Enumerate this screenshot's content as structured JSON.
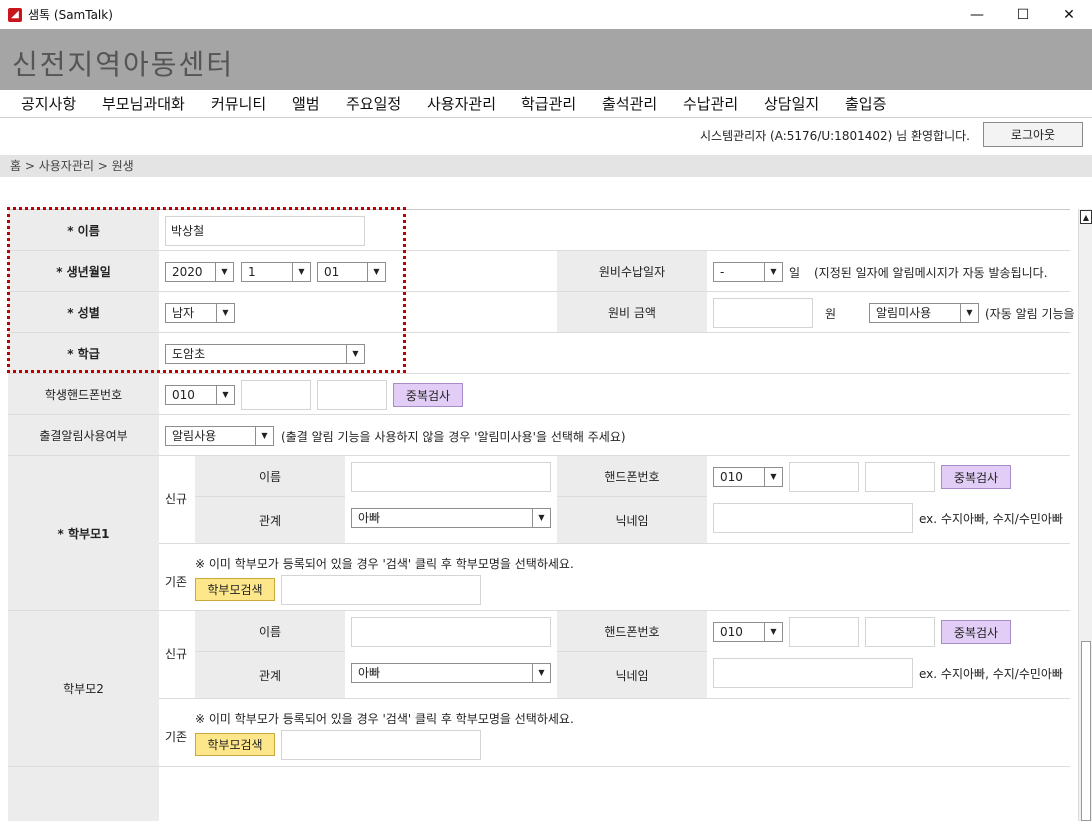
{
  "window": {
    "title": "샘톡 (SamTalk)",
    "minimize": "—",
    "maximize": "☐",
    "close": "✕"
  },
  "banner": {
    "org_name": "신전지역아동센터"
  },
  "menu": [
    "공지사항",
    "부모님과대화",
    "커뮤니티",
    "앨범",
    "주요일정",
    "사용자관리",
    "학급관리",
    "출석관리",
    "수납관리",
    "상담일지",
    "출입증"
  ],
  "userbar": {
    "welcome": "시스템관리자 (A:5176/U:1801402) 님 환영합니다.",
    "logout": "로그아웃"
  },
  "breadcrumb": "홈 > 사용자관리 > 원생",
  "form": {
    "name": {
      "label": "* 이름",
      "value": "박상철"
    },
    "birth": {
      "label": "* 생년월일",
      "year": "2020",
      "month": "1",
      "day": "01"
    },
    "gender": {
      "label": "* 성별",
      "value": "남자"
    },
    "class": {
      "label": "* 학급",
      "value": "도암초"
    },
    "fee_day": {
      "label": "원비수납일자",
      "value": "-",
      "unit": "일",
      "note": "(지정된 일자에 알림메시지가 자동 발송됩니다."
    },
    "fee_amount": {
      "label": "원비 금액",
      "value": "",
      "unit": "원",
      "alarm": "알림미사용",
      "note": "(자동 알림 기능을"
    },
    "student_phone": {
      "label": "학생핸드폰번호",
      "prefix": "010",
      "mid": "",
      "last": "",
      "dup_button": "중복검사"
    },
    "attendance_alarm": {
      "label": "출결알림사용여부",
      "value": "알림사용",
      "note": "(출결 알림 기능을 사용하지 않을 경우 '알림미사용'을 선택해 주세요)"
    },
    "parent1": {
      "label": "* 학부모1",
      "new_label": "신규",
      "name_label": "이름",
      "name_value": "",
      "phone_label": "핸드폰번호",
      "phone_prefix": "010",
      "phone_mid": "",
      "phone_last": "",
      "dup_button": "중복검사",
      "relation_label": "관계",
      "relation_value": "아빠",
      "nick_label": "닉네임",
      "nick_value": "",
      "nick_example": "ex. 수지아빠, 수지/수민아빠",
      "existing_label": "기존",
      "existing_note": "※ 이미 학부모가 등록되어 있을 경우 '검색' 클릭 후 학부모명을 선택하세요.",
      "search_button": "학부모검색",
      "search_value": ""
    },
    "parent2": {
      "label": "학부모2",
      "new_label": "신규",
      "name_label": "이름",
      "name_value": "",
      "phone_label": "핸드폰번호",
      "phone_prefix": "010",
      "phone_mid": "",
      "phone_last": "",
      "dup_button": "중복검사",
      "relation_label": "관계",
      "relation_value": "아빠",
      "nick_label": "닉네임",
      "nick_value": "",
      "nick_example": "ex. 수지아빠, 수지/수민아빠",
      "existing_label": "기존",
      "existing_note": "※ 이미 학부모가 등록되어 있을 경우 '검색' 클릭 후 학부모명을 선택하세요.",
      "search_button": "학부모검색",
      "search_value": ""
    }
  },
  "icons": {
    "dropdown": "▼",
    "scroll_up": "▲"
  },
  "colors": {
    "banner": "#a5a5a5",
    "highlight": "#c00000",
    "dup_button": "#e1cdf5",
    "search_button": "#fde78a"
  }
}
